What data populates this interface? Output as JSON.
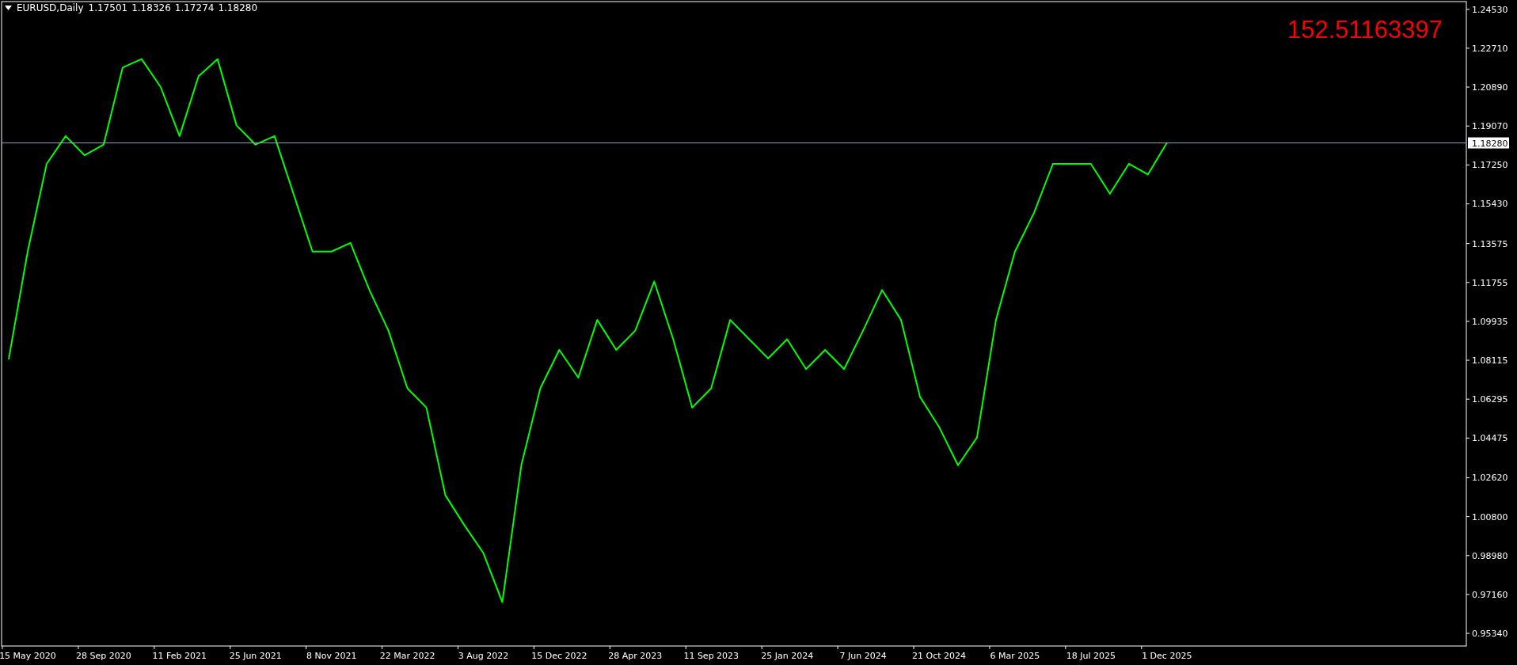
{
  "chart": {
    "symbol": "EURUSD,Daily",
    "ohlc": [
      "1.17501",
      "1.18326",
      "1.17274",
      "1.18280"
    ],
    "indicator_value": "152.51163397",
    "chart_data": {
      "type": "line",
      "categories": [
        null,
        "15 May 2020",
        null,
        null,
        null,
        "28 Sep 2020",
        null,
        null,
        null,
        "11 Feb 2021",
        null,
        null,
        null,
        "25 Jun 2021",
        null,
        null,
        null,
        "8 Nov 2021",
        null,
        null,
        null,
        "22 Mar 2022",
        null,
        null,
        null,
        "3 Aug 2022",
        null,
        null,
        null,
        "15 Dec 2022",
        null,
        null,
        null,
        "28 Apr 2023",
        null,
        null,
        null,
        "11 Sep 2023",
        null,
        null,
        null,
        "25 Jan 2024",
        null,
        null,
        null,
        "7 Jun 2024",
        null,
        null,
        null,
        "21 Oct 2024",
        null,
        null,
        null,
        "6 Mar 2025",
        null,
        null,
        null,
        "18 Jul 2025",
        null,
        null,
        null,
        "1 Dec 2025"
      ],
      "series": [
        {
          "color": "#00ff00",
          "values": [
            1.0816,
            1.132,
            1.173,
            1.186,
            1.177,
            1.182,
            1.218,
            1.222,
            1.209,
            1.186,
            1.214,
            1.222,
            1.191,
            1.182,
            1.186,
            1.159,
            1.132,
            1.132,
            1.136,
            1.114,
            1.095,
            1.068,
            1.059,
            1.018,
            1.004,
            0.991,
            0.968,
            1.032,
            1.068,
            1.086,
            1.073,
            1.1,
            1.086,
            1.095,
            1.118,
            1.091,
            1.059,
            1.068,
            1.1,
            1.091,
            1.082,
            1.091,
            1.077,
            1.086,
            1.077,
            1.095,
            1.114,
            1.1,
            1.064,
            1.05,
            1.032,
            1.045,
            1.1,
            1.132,
            1.15,
            1.173,
            1.173,
            1.173,
            1.159,
            1.173,
            1.168,
            1.1828
          ]
        }
      ],
      "ylim": [
        0.9475,
        1.2489
      ],
      "yticks": [
        {
          "value": 1.2453,
          "label": "1.24530"
        },
        {
          "value": 1.2271,
          "label": "1.22710"
        },
        {
          "value": 1.2089,
          "label": "1.20890"
        },
        {
          "value": 1.1907,
          "label": "1.19070"
        },
        {
          "value": 1.1725,
          "label": "1.17250"
        },
        {
          "value": 1.1543,
          "label": "1.15430"
        },
        {
          "value": 1.13575,
          "label": "1.13575"
        },
        {
          "value": 1.11755,
          "label": "1.11755"
        },
        {
          "value": 1.09935,
          "label": "1.09935"
        },
        {
          "value": 1.08115,
          "label": "1.08115"
        },
        {
          "value": 1.06295,
          "label": "1.06295"
        },
        {
          "value": 1.04475,
          "label": "1.04475"
        },
        {
          "value": 1.0262,
          "label": "1.02620"
        },
        {
          "value": 1.008,
          "label": "1.00800"
        },
        {
          "value": 0.9898,
          "label": "0.98980"
        },
        {
          "value": 0.9716,
          "label": "0.97160"
        },
        {
          "value": 0.9534,
          "label": "0.95340"
        }
      ],
      "ref_lines": [
        {
          "axis": "y",
          "value": 1.1828,
          "label": "1.18280"
        }
      ]
    }
  }
}
